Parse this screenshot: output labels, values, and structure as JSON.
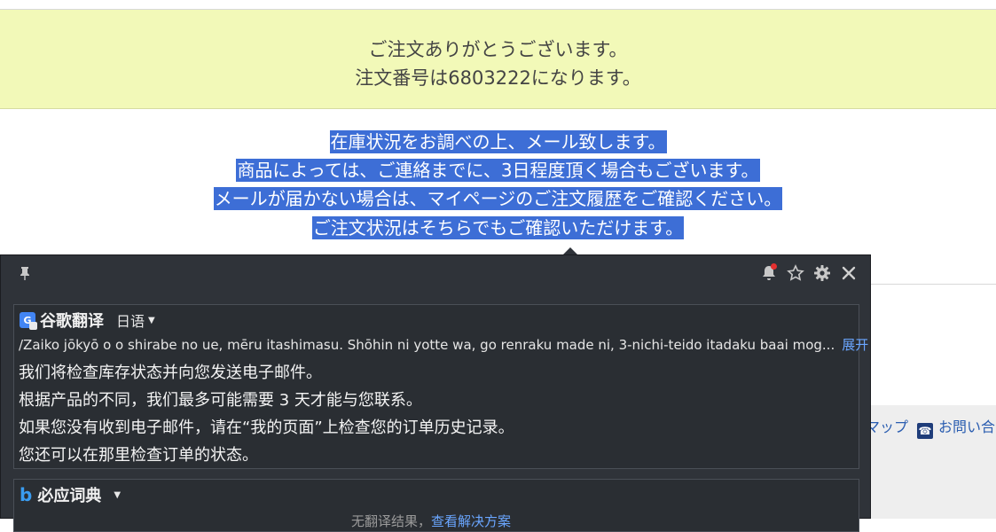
{
  "banner": {
    "line1": "ご注文ありがとうございます。",
    "line2": "注文番号は6803222になります。"
  },
  "selection": {
    "lines": [
      "在庫状況をお調べの上、メール致します。",
      "商品によっては、ご連絡までに、3日程度頂く場合もございます。",
      "メールが届かない場合は、マイページのご注文履歴をご確認ください。",
      "ご注文状況はそちらでもご確認いただけます。"
    ]
  },
  "footer": {
    "sitemap_label": "マップ",
    "contact_label": "お問い合"
  },
  "popup": {
    "icons": [
      "pin-icon",
      "bell-icon",
      "star-icon",
      "gear-icon",
      "close-icon"
    ],
    "notification_dot_color": "#e53030",
    "google": {
      "engine_name": "谷歌翻译",
      "source_lang": "日语",
      "romaji": "/Zaiko jōkyō o o shirabe no ue, mēru itashimasu. Shōhin ni yotte wa, go renraku made ni, 3-nichi-teido itadaku baai mog...",
      "expand_label": "展开",
      "translations": [
        "我们将检查库存状态并向您发送电子邮件。",
        "根据产品的不同，我们最多可能需要 3 天才能与您联系。",
        "如果您没有收到电子邮件，请在“我的页面”上检查您的订单历史记录。",
        "您还可以在那里检查订单的状态。"
      ]
    },
    "bing": {
      "engine_name": "必应词典",
      "footer_text": "无翻译结果，",
      "footer_link": "查看解决方案"
    }
  },
  "colors": {
    "banner_bg": "#f2f9b8",
    "selection_bg": "#3d6ed6",
    "popup_bg": "#2f3339",
    "link": "#6aa6ff"
  }
}
